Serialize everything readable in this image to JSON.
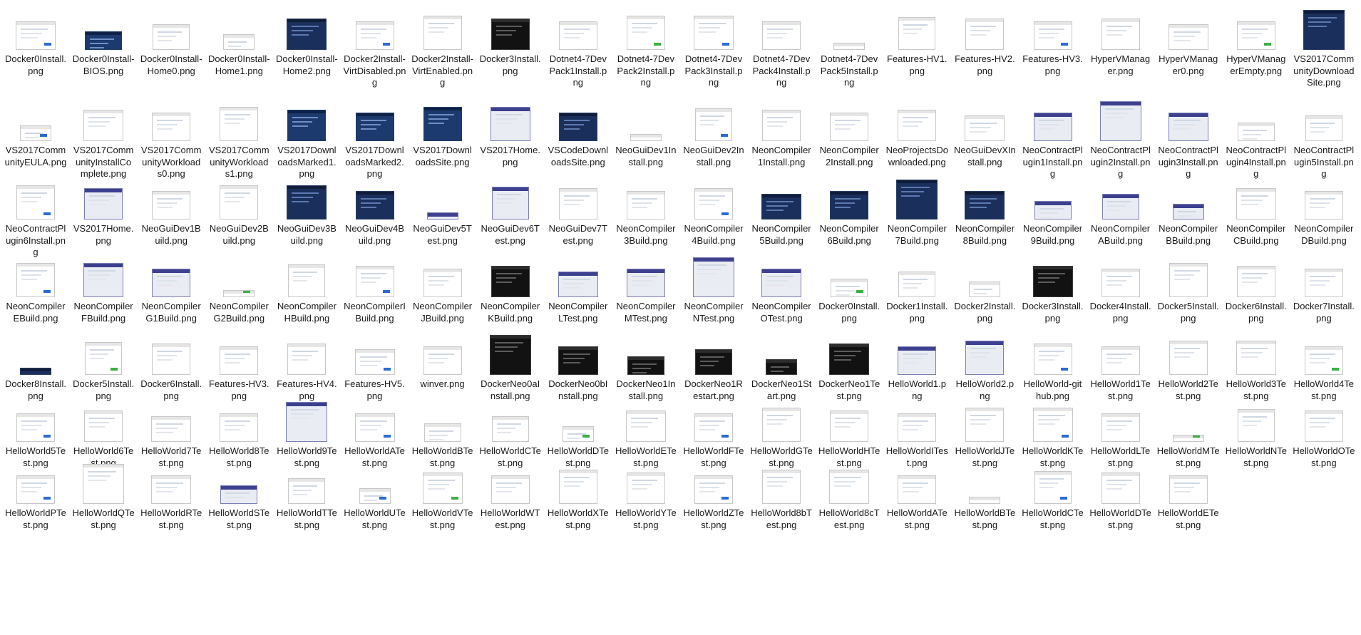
{
  "theme": {
    "accent_blue": "#2a6bd6",
    "accent_green": "#3cb043",
    "accent_purple": "#7c7fb3"
  },
  "files": [
    {
      "name": "Docker0Install.png",
      "style": "light"
    },
    {
      "name": "Docker0Install-BIOS.png",
      "style": "blue"
    },
    {
      "name": "Docker0Install-Home0.png",
      "style": "light"
    },
    {
      "name": "Docker0Install-Home1.png",
      "style": "light"
    },
    {
      "name": "Docker0Install-Home2.png",
      "style": "navy"
    },
    {
      "name": "Docker2Install-VirtDisabled.png",
      "style": "light"
    },
    {
      "name": "Docker2Install-VirtEnabled.png",
      "style": "light"
    },
    {
      "name": "Docker3Install.png",
      "style": "dark"
    },
    {
      "name": "Dotnet4-7DevPack1Install.png",
      "style": "light"
    },
    {
      "name": "Dotnet4-7DevPack2Install.png",
      "style": "light"
    },
    {
      "name": "Dotnet4-7DevPack3Install.png",
      "style": "light"
    },
    {
      "name": "Dotnet4-7DevPack4Install.png",
      "style": "light"
    },
    {
      "name": "Dotnet4-7DevPack5Install.png",
      "style": "light"
    },
    {
      "name": "Features-HV1.png",
      "style": "light"
    },
    {
      "name": "Features-HV2.png",
      "style": "light"
    },
    {
      "name": "Features-HV3.png",
      "style": "light"
    },
    {
      "name": "HyperVManager.png",
      "style": "light"
    },
    {
      "name": "HyperVManager0.png",
      "style": "light"
    },
    {
      "name": "HyperVManagerEmpty.png",
      "style": "light"
    },
    {
      "name": "VS2017CommunityDownloadSite.png",
      "style": "navy"
    },
    {
      "name": "VS2017CommunityEULA.png",
      "style": "light"
    },
    {
      "name": "VS2017CommunityInstallComplete.png",
      "style": "light"
    },
    {
      "name": "VS2017CommunityWorkloads0.png",
      "style": "light"
    },
    {
      "name": "VS2017CommunityWorkloads1.png",
      "style": "light"
    },
    {
      "name": "VS2017DownloadsMarked1.png",
      "style": "blue"
    },
    {
      "name": "VS2017DownloadsMarked2.png",
      "style": "blue"
    },
    {
      "name": "VS2017DownloadsSite.png",
      "style": "blue"
    },
    {
      "name": "VS2017Home.png",
      "style": "vs"
    },
    {
      "name": "VSCodeDownloadsSite.png",
      "style": "navy"
    },
    {
      "name": "NeoGuiDev1Install.png",
      "style": "light"
    },
    {
      "name": "NeoGuiDev2Install.png",
      "style": "light"
    },
    {
      "name": "NeonCompiler1Install.png",
      "style": "light"
    },
    {
      "name": "NeonCompiler2Install.png",
      "style": "light"
    },
    {
      "name": "NeoProjectsDownloaded.png",
      "style": "light"
    },
    {
      "name": "NeoGuiDevXInstall.png",
      "style": "light"
    },
    {
      "name": "NeoContractPlugin1Install.png",
      "style": "vs"
    },
    {
      "name": "NeoContractPlugin2Install.png",
      "style": "vs"
    },
    {
      "name": "NeoContractPlugin3Install.png",
      "style": "vs"
    },
    {
      "name": "NeoContractPlugin4Install.png",
      "style": "light"
    },
    {
      "name": "NeoContractPlugin5Install.png",
      "style": "light"
    },
    {
      "name": "NeoContractPlugin6Install.png",
      "style": "light"
    },
    {
      "name": "VS2017Home.png",
      "style": "vs"
    },
    {
      "name": "NeoGuiDev1Build.png",
      "style": "light"
    },
    {
      "name": "NeoGuiDev2Build.png",
      "style": "light"
    },
    {
      "name": "NeoGuiDev3Build.png",
      "style": "navy"
    },
    {
      "name": "NeoGuiDev4Build.png",
      "style": "navy"
    },
    {
      "name": "NeoGuiDev5Test.png",
      "style": "vs"
    },
    {
      "name": "NeoGuiDev6Test.png",
      "style": "vs"
    },
    {
      "name": "NeoGuiDev7Test.png",
      "style": "light"
    },
    {
      "name": "NeonCompiler3Build.png",
      "style": "light"
    },
    {
      "name": "NeonCompiler4Build.png",
      "style": "light"
    },
    {
      "name": "NeonCompiler5Build.png",
      "style": "navy"
    },
    {
      "name": "NeonCompiler6Build.png",
      "style": "navy"
    },
    {
      "name": "NeonCompiler7Build.png",
      "style": "navy"
    },
    {
      "name": "NeonCompiler8Build.png",
      "style": "navy"
    },
    {
      "name": "NeonCompiler9Build.png",
      "style": "vs"
    },
    {
      "name": "NeonCompilerABuild.png",
      "style": "vs"
    },
    {
      "name": "NeonCompilerBBuild.png",
      "style": "vs"
    },
    {
      "name": "NeonCompilerCBuild.png",
      "style": "light"
    },
    {
      "name": "NeonCompilerDBuild.png",
      "style": "light"
    },
    {
      "name": "NeonCompilerEBuild.png",
      "style": "light"
    },
    {
      "name": "NeonCompilerFBuild.png",
      "style": "vs"
    },
    {
      "name": "NeonCompilerG1Build.png",
      "style": "vs"
    },
    {
      "name": "NeonCompilerG2Build.png",
      "style": "light"
    },
    {
      "name": "NeonCompilerHBuild.png",
      "style": "light"
    },
    {
      "name": "NeonCompilerIBuild.png",
      "style": "light"
    },
    {
      "name": "NeonCompilerJBuild.png",
      "style": "light"
    },
    {
      "name": "NeonCompilerKBuild.png",
      "style": "dark"
    },
    {
      "name": "NeonCompilerLTest.png",
      "style": "vs"
    },
    {
      "name": "NeonCompilerMTest.png",
      "style": "vs"
    },
    {
      "name": "NeonCompilerNTest.png",
      "style": "vs"
    },
    {
      "name": "NeonCompilerOTest.png",
      "style": "vs"
    },
    {
      "name": "Docker0Install.png",
      "style": "light"
    },
    {
      "name": "Docker1Install.png",
      "style": "light"
    },
    {
      "name": "Docker2Install.png",
      "style": "light"
    },
    {
      "name": "Docker3Install.png",
      "style": "dark"
    },
    {
      "name": "Docker4Install.png",
      "style": "light"
    },
    {
      "name": "Docker5Install.png",
      "style": "light"
    },
    {
      "name": "Docker6Install.png",
      "style": "light"
    },
    {
      "name": "Docker7Install.png",
      "style": "light"
    },
    {
      "name": "Docker8Install.png",
      "style": "navy"
    },
    {
      "name": "Docker5Install.png",
      "style": "light"
    },
    {
      "name": "Docker6Install.png",
      "style": "light"
    },
    {
      "name": "Features-HV3.png",
      "style": "light"
    },
    {
      "name": "Features-HV4.png",
      "style": "light"
    },
    {
      "name": "Features-HV5.png",
      "style": "light"
    },
    {
      "name": "winver.png",
      "style": "light"
    },
    {
      "name": "DockerNeo0aInstall.png",
      "style": "dark"
    },
    {
      "name": "DockerNeo0bInstall.png",
      "style": "dark"
    },
    {
      "name": "DockerNeo1Install.png",
      "style": "dark"
    },
    {
      "name": "DockerNeo1Restart.png",
      "style": "dark"
    },
    {
      "name": "DockerNeo1Start.png",
      "style": "dark"
    },
    {
      "name": "DockerNeo1Test.png",
      "style": "dark"
    },
    {
      "name": "HelloWorld1.png",
      "style": "vs"
    },
    {
      "name": "HelloWorld2.png",
      "style": "vs"
    },
    {
      "name": "HelloWorld-github.png",
      "style": "light"
    },
    {
      "name": "HelloWorld1Test.png",
      "style": "light"
    },
    {
      "name": "HelloWorld2Test.png",
      "style": "light"
    },
    {
      "name": "HelloWorld3Test.png",
      "style": "light"
    },
    {
      "name": "HelloWorld4Test.png",
      "style": "light"
    },
    {
      "name": "HelloWorld5Test.png",
      "style": "light"
    },
    {
      "name": "HelloWorld6Test.png",
      "style": "light"
    },
    {
      "name": "HelloWorld7Test.png",
      "style": "light"
    },
    {
      "name": "HelloWorld8Test.png",
      "style": "light"
    },
    {
      "name": "HelloWorld9Test.png",
      "style": "vs"
    },
    {
      "name": "HelloWorldATest.png",
      "style": "light"
    },
    {
      "name": "HelloWorldBTest.png",
      "style": "light"
    },
    {
      "name": "HelloWorldCTest.png",
      "style": "light"
    },
    {
      "name": "HelloWorldDTest.png",
      "style": "light"
    },
    {
      "name": "HelloWorldETest.png",
      "style": "light"
    },
    {
      "name": "HelloWorldFTest.png",
      "style": "light"
    },
    {
      "name": "HelloWorldGTest.png",
      "style": "light"
    },
    {
      "name": "HelloWorldHTest.png",
      "style": "light"
    },
    {
      "name": "HelloWorldITest.png",
      "style": "light"
    },
    {
      "name": "HelloWorldJTest.png",
      "style": "light"
    },
    {
      "name": "HelloWorldKTest.png",
      "style": "light"
    },
    {
      "name": "HelloWorldLTest.png",
      "style": "light"
    },
    {
      "name": "HelloWorldMTest.png",
      "style": "light"
    },
    {
      "name": "HelloWorldNTest.png",
      "style": "light"
    },
    {
      "name": "HelloWorldOTest.png",
      "style": "light"
    },
    {
      "name": "HelloWorldPTest.png",
      "style": "light"
    },
    {
      "name": "HelloWorldQTest.png",
      "style": "light"
    },
    {
      "name": "HelloWorldRTest.png",
      "style": "light"
    },
    {
      "name": "HelloWorldSTest.png",
      "style": "vs"
    },
    {
      "name": "HelloWorldTTest.png",
      "style": "light"
    },
    {
      "name": "HelloWorldUTest.png",
      "style": "light"
    },
    {
      "name": "HelloWorldVTest.png",
      "style": "light"
    },
    {
      "name": "HelloWorldWTest.png",
      "style": "light"
    },
    {
      "name": "HelloWorldXTest.png",
      "style": "light"
    },
    {
      "name": "HelloWorldYTest.png",
      "style": "light"
    },
    {
      "name": "HelloWorldZTest.png",
      "style": "light"
    },
    {
      "name": "HelloWorld8bTest.png",
      "style": "light"
    },
    {
      "name": "HelloWorld8cTest.png",
      "style": "light"
    },
    {
      "name": "HelloWorldATest.png",
      "style": "light"
    },
    {
      "name": "HelloWorldBTest.png",
      "style": "light"
    },
    {
      "name": "HelloWorldCTest.png",
      "style": "light"
    },
    {
      "name": "HelloWorldDTest.png",
      "style": "light"
    },
    {
      "name": "HelloWorldETest.png",
      "style": "light"
    }
  ]
}
